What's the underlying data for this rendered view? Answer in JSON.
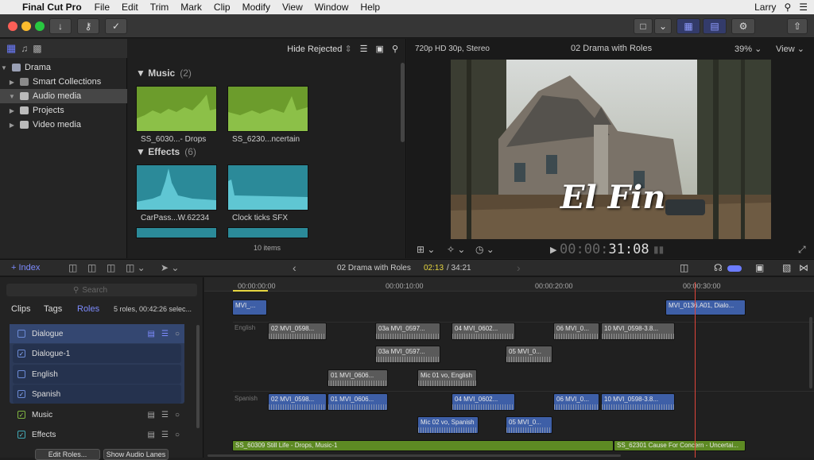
{
  "menubar": {
    "apple": "",
    "app": "Final Cut Pro",
    "items": [
      "File",
      "Edit",
      "Trim",
      "Mark",
      "Clip",
      "Modify",
      "View",
      "Window",
      "Help"
    ],
    "user": "Larry"
  },
  "library": {
    "items": [
      {
        "label": "Drama"
      },
      {
        "label": "Smart Collections"
      },
      {
        "label": "Audio media"
      },
      {
        "label": "Projects"
      },
      {
        "label": "Video media"
      }
    ]
  },
  "browser": {
    "filter": "Hide Rejected",
    "sections": [
      {
        "title": "Music",
        "count": "(2)"
      },
      {
        "title": "Effects",
        "count": "(6)"
      }
    ],
    "clips": [
      {
        "name": "SS_6030...- Drops"
      },
      {
        "name": "SS_6230...ncertain"
      },
      {
        "name": "CarPass...W.62234"
      },
      {
        "name": "Clock ticks SFX"
      }
    ],
    "footer": "10 items"
  },
  "viewer": {
    "format": "720p HD 30p, Stereo",
    "title": "02 Drama with Roles",
    "zoom": "39%",
    "view_label": "View",
    "overlay_title": "El Fin",
    "timecode_dim": "00:00:",
    "timecode": "31:08"
  },
  "timeline_bar": {
    "index_label": "Index",
    "project": "02 Drama with Roles",
    "time_current": "02:13",
    "time_total": "/ 34:21"
  },
  "index": {
    "search_placeholder": "Search",
    "tabs": [
      "Clips",
      "Tags",
      "Roles"
    ],
    "summary": "5 roles, 00:42:26 selec...",
    "roles": [
      {
        "label": "Dialogue"
      },
      {
        "label": "Dialogue-1"
      },
      {
        "label": "English"
      },
      {
        "label": "Spanish"
      },
      {
        "label": "Music"
      },
      {
        "label": "Effects"
      }
    ],
    "edit_roles": "Edit Roles...",
    "show_lanes": "Show Audio Lanes"
  },
  "timeline": {
    "ruler": [
      "00:00:00:00",
      "00:00:10:00",
      "00:00:20:00",
      "00:00:30:00"
    ],
    "lanes": [
      "English",
      "Spanish"
    ],
    "clips": [
      {
        "label": "MVI_..."
      },
      {
        "label": "MVI_0136.A01, Dialo..."
      },
      {
        "label": "02 MVI_0598..."
      },
      {
        "label": "03a MVI_0597..."
      },
      {
        "label": "04 MVI_0602..."
      },
      {
        "label": "06 MVI_0..."
      },
      {
        "label": "10 MVI_0598-3.8..."
      },
      {
        "label": "03a MVI_0597..."
      },
      {
        "label": "05 MVI_0..."
      },
      {
        "label": "01 MVI_0606..."
      },
      {
        "label": "Mic 01 vo, English"
      },
      {
        "label": "02 MVI_0598..."
      },
      {
        "label": "01 MVI_0606..."
      },
      {
        "label": "04 MVI_0602..."
      },
      {
        "label": "06 MVI_0..."
      },
      {
        "label": "10 MVI_0598-3.8..."
      },
      {
        "label": "Mic 02 vo, Spanish"
      },
      {
        "label": "05 MVI_0..."
      },
      {
        "label": "SS_60309 Still Life - Drops, Music-1"
      },
      {
        "label": "SS_62301 Cause For Concern - Uncertai..."
      }
    ]
  },
  "colors": {
    "accent": "#6c7cff",
    "playhead": "#e0453a",
    "dialogue_clip": "#3e5fa7",
    "music_clip": "#5d8a23",
    "timecode_yellow": "#e6d640"
  }
}
